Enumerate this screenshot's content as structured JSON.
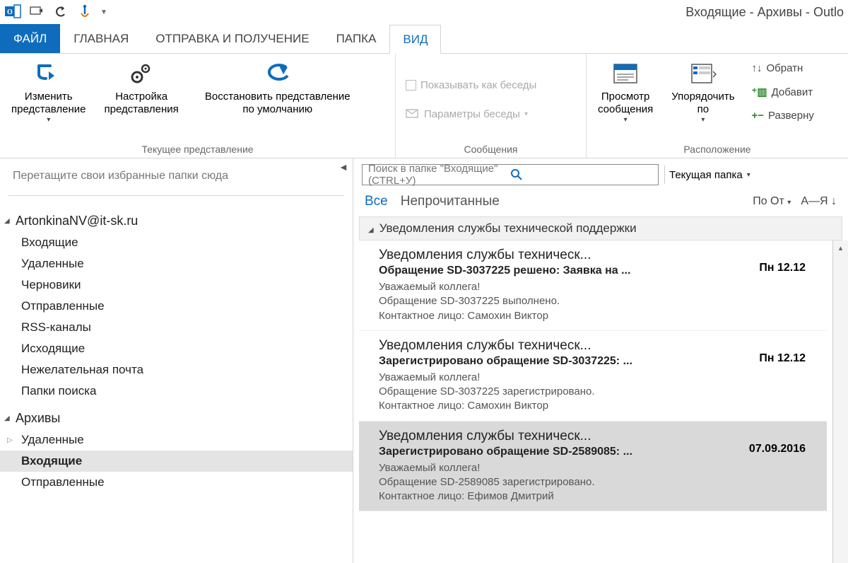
{
  "titlebar": {
    "title": "Входящие - Архивы - Outlo"
  },
  "ribbon_tabs": {
    "file": "ФАЙЛ",
    "home": "ГЛАВНАЯ",
    "sendreceive": "ОТПРАВКА И ПОЛУЧЕНИЕ",
    "folder": "ПАПКА",
    "view": "ВИД"
  },
  "ribbon": {
    "group_view_label": "Текущее представление",
    "change_view": "Изменить\nпредставление",
    "view_settings": "Настройка\nпредставления",
    "reset_view": "Восстановить представление\nпо умолчанию",
    "group_msgs_label": "Сообщения",
    "show_as_convo": "Показывать как беседы",
    "convo_settings": "Параметры беседы",
    "group_arrange_label": "Расположение",
    "msg_preview": "Просмотр\nсообщения",
    "arrange_by": "Упорядочить\nпо",
    "reverse_sort": "Обратн",
    "add_columns": "Добавит",
    "expand": "Разверну"
  },
  "sidebar": {
    "fav_hint": "Перетащите свои избранные папки сюда",
    "account": "ArtonkinaNV@it-sk.ru",
    "folders": {
      "inbox": "Входящие",
      "deleted": "Удаленные",
      "drafts": "Черновики",
      "sent": "Отправленные",
      "rss": "RSS-каналы",
      "outbox": "Исходящие",
      "junk": "Нежелательная почта",
      "search": "Папки поиска"
    },
    "archives": "Архивы",
    "arch_deleted": "Удаленные",
    "arch_inbox": "Входящие",
    "arch_sent": "Отправленные"
  },
  "search": {
    "placeholder": "Поиск в папке \"Входящие\" (CTRL+У)",
    "scope": "Текущая папка"
  },
  "filters": {
    "all": "Все",
    "unread": "Непрочитанные",
    "sort_by": "По От",
    "az": "А—Я"
  },
  "group_header": "Уведомления службы технической поддержки",
  "messages": [
    {
      "from": "Уведомления службы техническ...",
      "subject": "Обращение SD-3037225 решено: Заявка на ...",
      "date": "Пн 12.12",
      "preview": "Уважаемый коллега!\nОбращение SD-3037225 выполнено.\nКонтактное лицо: Самохин Виктор"
    },
    {
      "from": "Уведомления службы техническ...",
      "subject": "Зарегистрировано обращение SD-3037225: ...",
      "date": "Пн 12.12",
      "preview": "Уважаемый коллега!\nОбращение SD-3037225 зарегистрировано.\nКонтактное лицо: Самохин Виктор"
    },
    {
      "from": "Уведомления службы техническ...",
      "subject": "Зарегистрировано обращение SD-2589085: ...",
      "date": "07.09.2016",
      "preview": "Уважаемый коллега!\nОбращение SD-2589085 зарегистрировано.\nКонтактное лицо: Ефимов Дмитрий"
    }
  ]
}
